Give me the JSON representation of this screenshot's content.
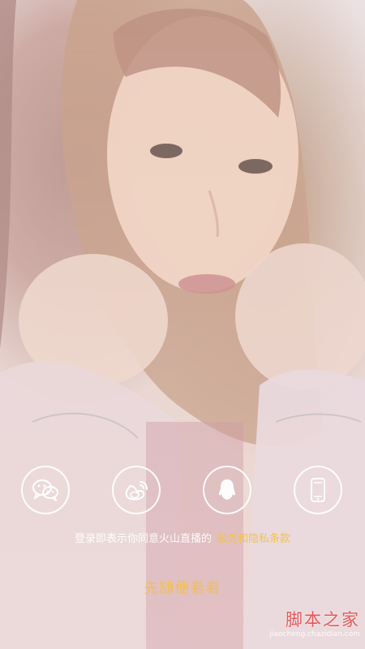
{
  "share": {
    "wechat_icon": "wechat-icon",
    "weibo_icon": "weibo-icon",
    "qq_icon": "qq-icon",
    "phone_icon": "phone-icon"
  },
  "terms": {
    "prefix": "登录即表示你同意火山直播的",
    "link": "服务和隐私条款"
  },
  "browse_label": "先随便看看",
  "watermark": {
    "title": "脚本之家",
    "subtitle": "jiaocheng.chazidian.com"
  },
  "colors": {
    "accent": "#f4c04a",
    "link": "#f2c24d",
    "watermark": "#e45757"
  }
}
